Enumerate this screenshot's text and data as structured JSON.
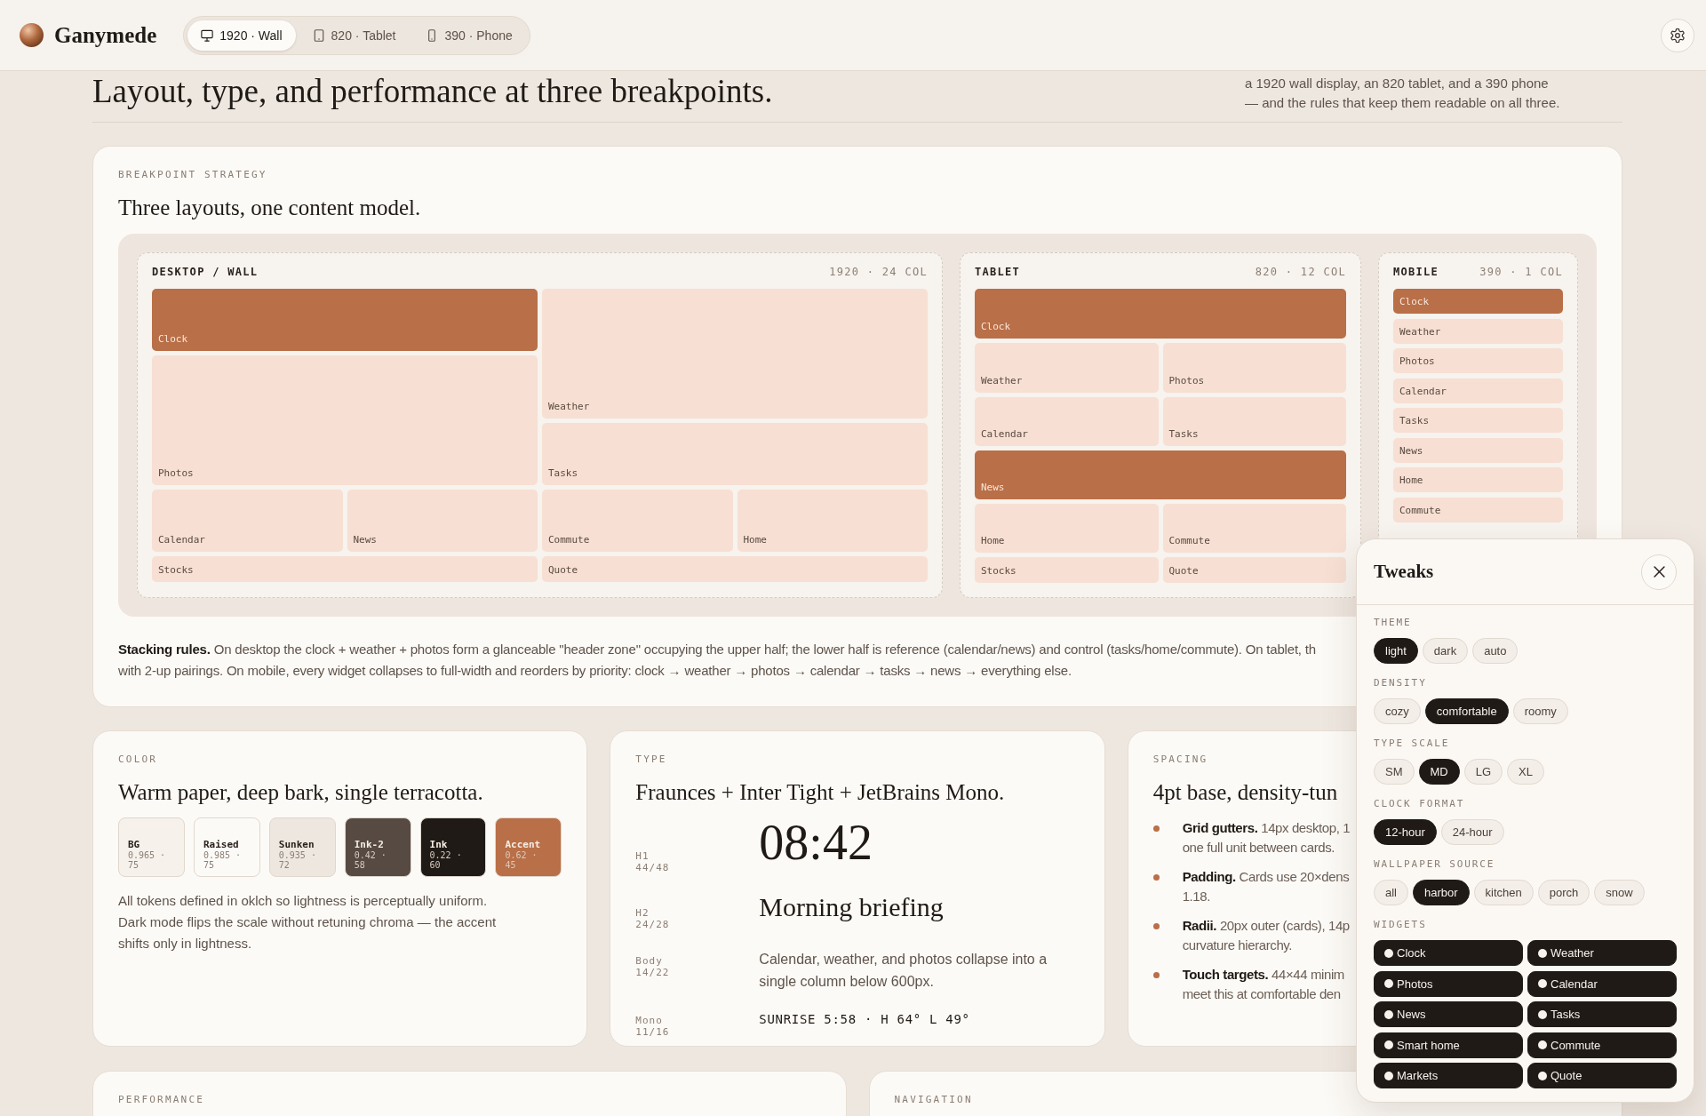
{
  "top_bar": {
    "brand": "Ganymede",
    "breakpoints": [
      {
        "label": "1920 · Wall",
        "kind": "monitor",
        "selected": true
      },
      {
        "label": "820 · Tablet",
        "kind": "tablet",
        "selected": false
      },
      {
        "label": "390 · Phone",
        "kind": "phone",
        "selected": false
      }
    ]
  },
  "header": {
    "title": "Layout, type, and performance at three breakpoints.",
    "intro": "a 1920 wall display, an 820 tablet, and a 390 phone\n— and the rules that keep them readable on all three."
  },
  "breakpoint_strategy": {
    "label": "BREAKPOINT STRATEGY",
    "title": "Three layouts, one content model.",
    "layouts": [
      {
        "kind": "desktop",
        "name": "DESKTOP / WALL",
        "spec": "1920 · 24 COL",
        "widgets": [
          {
            "label": "Clock",
            "accent": true
          },
          {
            "label": "Weather",
            "accent": false
          },
          {
            "label": "Photos",
            "accent": false
          },
          {
            "label": "Tasks",
            "accent": false
          },
          {
            "label": "Calendar",
            "accent": false
          },
          {
            "label": "News",
            "accent": false
          },
          {
            "label": "Commute",
            "accent": false
          },
          {
            "label": "Home",
            "accent": false
          },
          {
            "label": "Stocks",
            "accent": false
          },
          {
            "label": "Quote",
            "accent": false
          }
        ]
      },
      {
        "kind": "tablet",
        "name": "TABLET",
        "spec": "820 · 12 COL",
        "widgets": [
          {
            "label": "Clock",
            "accent": true
          },
          {
            "label": "Weather",
            "accent": false
          },
          {
            "label": "Photos",
            "accent": false
          },
          {
            "label": "Calendar",
            "accent": false
          },
          {
            "label": "Tasks",
            "accent": false
          },
          {
            "label": "News",
            "accent": true
          },
          {
            "label": "Home",
            "accent": false
          },
          {
            "label": "Commute",
            "accent": false
          },
          {
            "label": "Stocks",
            "accent": false
          },
          {
            "label": "Quote",
            "accent": false
          }
        ]
      },
      {
        "kind": "mobile",
        "name": "MOBILE",
        "spec": "390 · 1 COL",
        "widgets": [
          {
            "label": "Clock",
            "accent": true
          },
          {
            "label": "Weather",
            "accent": false
          },
          {
            "label": "Photos",
            "accent": false
          },
          {
            "label": "Calendar",
            "accent": false
          },
          {
            "label": "Tasks",
            "accent": false
          },
          {
            "label": "News",
            "accent": false
          },
          {
            "label": "Home",
            "accent": false
          },
          {
            "label": "Commute",
            "accent": false
          }
        ]
      }
    ],
    "note": "**Stacking rules.** On desktop the clock + weather + photos form a glanceable \"header zone\" occupying the upper half; the lower half is reference (calendar/news) and control (tasks/home/commute). On tablet, th\nwith 2-up pairings. On mobile, every widget collapses to full-width and reorders by priority: clock → weather → photos → calendar → tasks → news → everything else."
  },
  "color": {
    "label": "COLOR",
    "title": "Warm paper, deep bark, single terracotta.",
    "swatches": [
      {
        "name": "BG",
        "value": "0.965 · 75",
        "color": "#f6f1eb"
      },
      {
        "name": "Raised",
        "value": "0.985 · 75",
        "color": "#fcfaf7"
      },
      {
        "name": "Sunken",
        "value": "0.935 · 72",
        "color": "#eee7e0"
      },
      {
        "name": "Ink-2",
        "value": "0.42 · 58",
        "color": "#564a43"
      },
      {
        "name": "Ink",
        "value": "0.22 · 60",
        "color": "#1f1a15"
      },
      {
        "name": "Accent",
        "value": "0.62 · 45",
        "color": "#b96f47"
      }
    ],
    "description": "All tokens defined in oklch so lightness is perceptually uniform. Dark mode flips the scale without retuning chroma — the accent shifts only in lightness."
  },
  "type": {
    "label": "TYPE",
    "title": "Fraunces + Inter Tight + JetBrains Mono.",
    "samples": [
      {
        "kind": "display",
        "label": "H1",
        "metrics": "44/48",
        "sample": "08:42"
      },
      {
        "kind": "heading",
        "label": "H2",
        "metrics": "24/28",
        "sample": "Morning briefing"
      },
      {
        "kind": "body",
        "label": "Body",
        "metrics": "14/22",
        "sample": "Calendar, weather, and photos collapse into a single column below 600px."
      },
      {
        "kind": "mono",
        "label": "Mono",
        "metrics": "11/16",
        "sample": "SUNRISE 5:58 · H 64° L 49°"
      }
    ]
  },
  "spacing": {
    "label": "SPACING",
    "title": "4pt base, density-tun",
    "rules": [
      "**Grid gutters.** 14px desktop, 1\none full unit between cards.",
      "**Padding.** Cards use 20×dens\n1.18.",
      "**Radii.** 20px outer (cards), 14p\ncurvature hierarchy.",
      "**Touch targets.** 44×44 minim\nmeet this at comfortable den"
    ]
  },
  "performance": {
    "label": "PERFORMANCE"
  },
  "navigation": {
    "label": "NAVIGATION"
  },
  "tweaks": {
    "title": "Tweaks",
    "groups": [
      {
        "label": "THEME",
        "options": [
          {
            "label": "light",
            "selected": true
          },
          {
            "label": "dark",
            "selected": false
          },
          {
            "label": "auto",
            "selected": false
          }
        ]
      },
      {
        "label": "DENSITY",
        "options": [
          {
            "label": "cozy",
            "selected": false
          },
          {
            "label": "comfortable",
            "selected": true
          },
          {
            "label": "roomy",
            "selected": false
          }
        ]
      },
      {
        "label": "TYPE SCALE",
        "options": [
          {
            "label": "SM",
            "selected": false
          },
          {
            "label": "MD",
            "selected": true
          },
          {
            "label": "LG",
            "selected": false
          },
          {
            "label": "XL",
            "selected": false
          }
        ]
      },
      {
        "label": "CLOCK FORMAT",
        "options": [
          {
            "label": "12-hour",
            "selected": true
          },
          {
            "label": "24-hour",
            "selected": false
          }
        ]
      },
      {
        "label": "WALLPAPER SOURCE",
        "options": [
          {
            "label": "all",
            "selected": false
          },
          {
            "label": "harbor",
            "selected": true
          },
          {
            "label": "kitchen",
            "selected": false
          },
          {
            "label": "porch",
            "selected": false
          },
          {
            "label": "snow",
            "selected": false
          }
        ]
      }
    ],
    "widgets": {
      "label": "WIDGETS",
      "items": [
        {
          "label": "Clock",
          "on": true
        },
        {
          "label": "Weather",
          "on": true
        },
        {
          "label": "Photos",
          "on": true
        },
        {
          "label": "Calendar",
          "on": true
        },
        {
          "label": "News",
          "on": true
        },
        {
          "label": "Tasks",
          "on": true
        },
        {
          "label": "Smart home",
          "on": true
        },
        {
          "label": "Commute",
          "on": true
        },
        {
          "label": "Markets",
          "on": true
        },
        {
          "label": "Quote",
          "on": true
        }
      ]
    }
  }
}
